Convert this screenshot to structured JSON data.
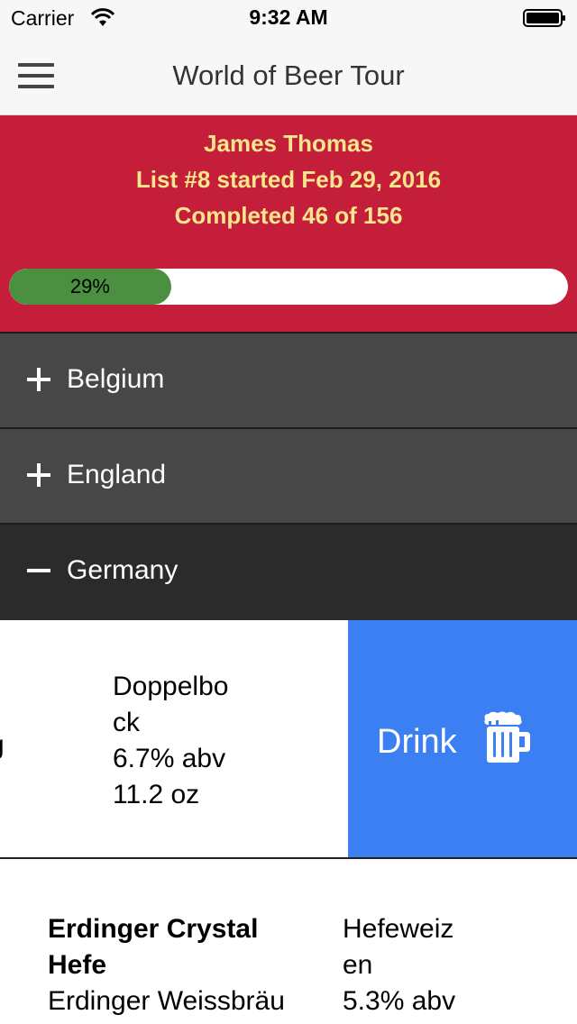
{
  "status_bar": {
    "carrier": "Carrier",
    "time": "9:32 AM"
  },
  "nav": {
    "title": "World of Beer Tour",
    "menu_icon": "hamburger-menu-icon"
  },
  "profile": {
    "name": "James Thomas",
    "list_info": "List #8 started Feb 29, 2016",
    "completed": "Completed 46 of 156",
    "progress_label": "29%",
    "progress_fraction": 0.29
  },
  "colors": {
    "header_bg": "#c41e3a",
    "header_text": "#f8e68c",
    "progress_fill": "#4a9040",
    "country_bg": "#474747",
    "country_expanded_bg": "#2b2b2b",
    "drink_bg": "#3b7ff2"
  },
  "countries": [
    {
      "name": "Belgium",
      "expanded": false
    },
    {
      "name": "England",
      "expanded": false
    },
    {
      "name": "Germany",
      "expanded": true
    }
  ],
  "beers": [
    {
      "clipped_text": "g",
      "style_line1": "Doppelbo",
      "style_line2": "ck",
      "abv": "6.7% abv",
      "size": "11.2 oz",
      "action_label": "Drink",
      "action_icon": "beer-mug-icon"
    },
    {
      "name": "Erdinger Crystal Hefe",
      "brewery": "Erdinger Weissbräu",
      "style_line1": "Hefeweiz",
      "style_line2": "en",
      "abv": "5.3% abv"
    }
  ]
}
